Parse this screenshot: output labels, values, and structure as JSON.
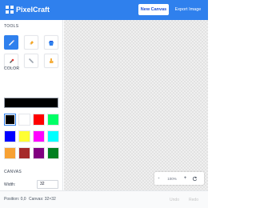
{
  "header": {
    "title": "PixelCraft",
    "new_canvas_label": "New Canvas",
    "export_label": "Export Image",
    "bg_color": "#2f80ed"
  },
  "sidebar": {
    "tools_title": "TOOLS",
    "tools": [
      {
        "name": "pencil",
        "active": true
      },
      {
        "name": "eraser",
        "active": false
      },
      {
        "name": "fill-bucket",
        "active": false
      },
      {
        "name": "color-picker",
        "active": false
      },
      {
        "name": "line",
        "active": false
      },
      {
        "name": "pointer",
        "active": false
      }
    ],
    "color_title": "COLOR",
    "current_color": "#000000",
    "swatches": [
      "#000000",
      "#ffffff",
      "#ff0000",
      "#00ff66",
      "#0000ff",
      "#ffff33",
      "#ff00ff",
      "#00ffff",
      "#f7a133",
      "#a52a2a",
      "#800080",
      "#008020"
    ],
    "canvas_title": "CANVAS",
    "width_label": "Width:",
    "width_value": "32"
  },
  "zoom": {
    "minus_label": "-",
    "level": "100%",
    "plus_label": "+",
    "reset_icon": "reset-icon"
  },
  "status": {
    "position": "Position: 0,0",
    "canvas": "Canvas: 32×32",
    "undo_label": "Undo",
    "redo_label": "Redo"
  }
}
